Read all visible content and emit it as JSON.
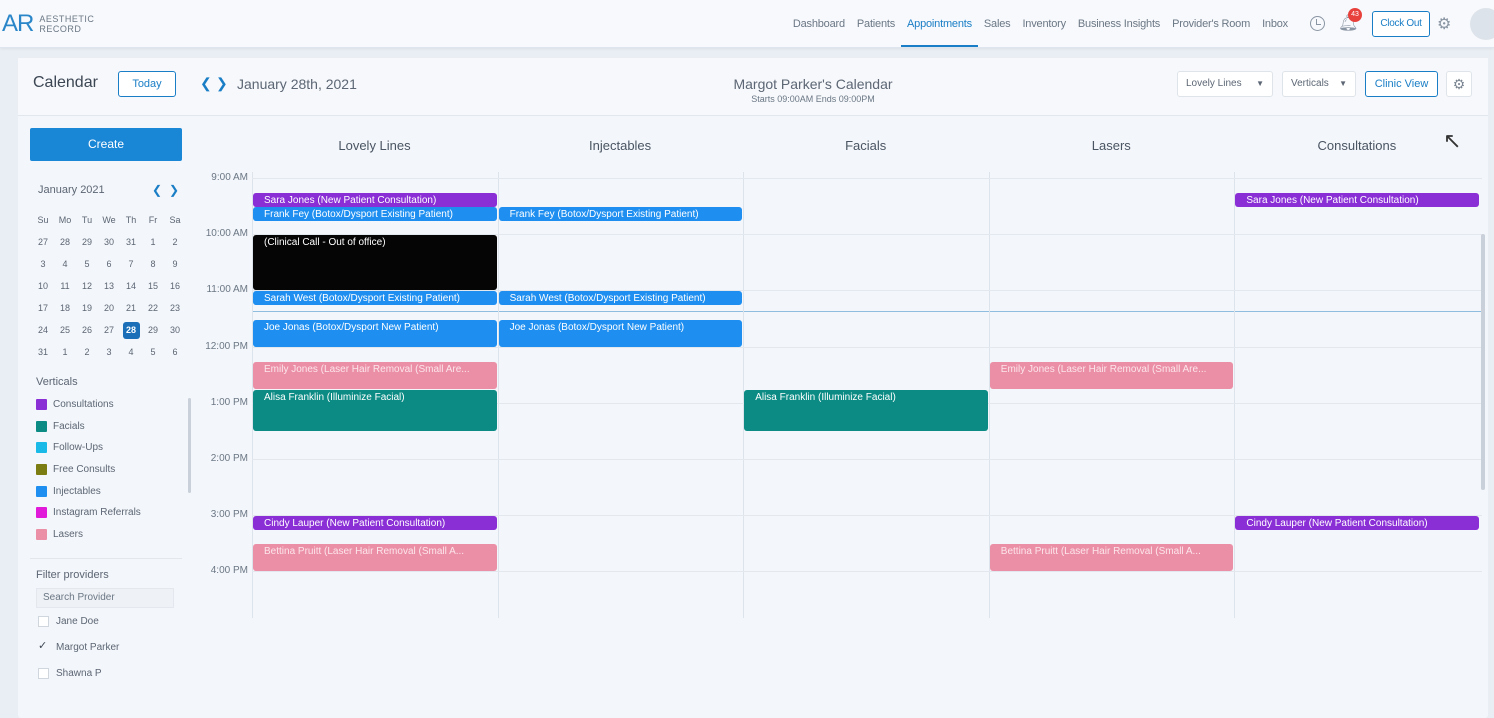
{
  "logo": {
    "mark": "AR",
    "line1": "AESTHETIC",
    "line2": "RECORD"
  },
  "nav": [
    "Dashboard",
    "Patients",
    "Appointments",
    "Sales",
    "Inventory",
    "Business Insights",
    "Provider's Room",
    "Inbox"
  ],
  "nav_active": "Appointments",
  "notifications": "43",
  "clock_out": "Clock Out",
  "header": {
    "title": "Calendar",
    "today": "Today",
    "date": "January 28th, 2021",
    "calendar_owner": "Margot Parker's Calendar",
    "hours": "Starts 09:00AM  Ends 09:00PM",
    "location": "Lovely Lines",
    "group": "Verticals",
    "view": "Clinic View"
  },
  "sidebar": {
    "create": "Create",
    "month": "January 2021",
    "weekdays": [
      "Su",
      "Mo",
      "Tu",
      "We",
      "Th",
      "Fr",
      "Sa"
    ],
    "days": [
      "27",
      "28",
      "29",
      "30",
      "31",
      "1",
      "2",
      "3",
      "4",
      "5",
      "6",
      "7",
      "8",
      "9",
      "10",
      "11",
      "12",
      "13",
      "14",
      "15",
      "16",
      "17",
      "18",
      "19",
      "20",
      "21",
      "22",
      "23",
      "24",
      "25",
      "26",
      "27",
      "28",
      "29",
      "30",
      "31",
      "1",
      "2",
      "3",
      "4",
      "5",
      "6"
    ],
    "selected_day": "28",
    "verticals_title": "Verticals",
    "verticals": [
      {
        "label": "Consultations",
        "color": "#8a2ed6"
      },
      {
        "label": "Facials",
        "color": "#0b8b84"
      },
      {
        "label": "Follow-Ups",
        "color": "#19b9e8"
      },
      {
        "label": "Free Consults",
        "color": "#7b7d12"
      },
      {
        "label": "Injectables",
        "color": "#1e8ff0"
      },
      {
        "label": "Instagram Referrals",
        "color": "#e01ad8"
      },
      {
        "label": "Lasers",
        "color": "#eb8fa6"
      }
    ],
    "filter_title": "Filter providers",
    "search_placeholder": "Search Provider",
    "providers": [
      {
        "name": "Jane Doe",
        "checked": false
      },
      {
        "name": "Margot Parker",
        "checked": true
      },
      {
        "name": "Shawna P",
        "checked": false
      }
    ]
  },
  "columns": [
    "Lovely Lines",
    "Injectables",
    "Facials",
    "Lasers",
    "Consultations"
  ],
  "times": [
    "9:00 AM",
    "10:00 AM",
    "11:00 AM",
    "12:00 PM",
    "1:00 PM",
    "2:00 PM",
    "3:00 PM",
    "4:00 PM"
  ],
  "events": [
    {
      "col": 0,
      "start": "9:15",
      "end": "9:30",
      "color": "c-purple",
      "label": "Sara Jones (New Patient Consultation)"
    },
    {
      "col": 0,
      "start": "9:30",
      "end": "9:45",
      "color": "c-blue",
      "label": "Frank Fey (Botox/Dysport Existing Patient)"
    },
    {
      "col": 0,
      "start": "10:00",
      "end": "11:00",
      "color": "c-black",
      "label": "(Clinical Call - Out of office)"
    },
    {
      "col": 0,
      "start": "11:00",
      "end": "11:15",
      "color": "c-blue",
      "label": "Sarah West (Botox/Dysport Existing Patient)"
    },
    {
      "col": 0,
      "start": "11:30",
      "end": "12:00",
      "color": "c-blue",
      "label": "Joe Jonas (Botox/Dysport New Patient)"
    },
    {
      "col": 0,
      "start": "12:15",
      "end": "12:45",
      "color": "c-pink",
      "label": "Emily Jones (Laser Hair Removal (Small Are..."
    },
    {
      "col": 0,
      "start": "12:45",
      "end": "13:30",
      "color": "c-teal",
      "label": "Alisa Franklin (Illuminize Facial)"
    },
    {
      "col": 0,
      "start": "15:00",
      "end": "15:15",
      "color": "c-purple",
      "label": "Cindy Lauper (New Patient Consultation)"
    },
    {
      "col": 0,
      "start": "15:30",
      "end": "16:00",
      "color": "c-pink",
      "label": "Bettina Pruitt (Laser Hair Removal (Small A..."
    },
    {
      "col": 1,
      "start": "9:30",
      "end": "9:45",
      "color": "c-blue",
      "label": "Frank Fey (Botox/Dysport Existing Patient)"
    },
    {
      "col": 1,
      "start": "11:00",
      "end": "11:15",
      "color": "c-blue",
      "label": "Sarah West (Botox/Dysport Existing Patient)"
    },
    {
      "col": 1,
      "start": "11:30",
      "end": "12:00",
      "color": "c-blue",
      "label": "Joe Jonas (Botox/Dysport New Patient)"
    },
    {
      "col": 2,
      "start": "12:45",
      "end": "13:30",
      "color": "c-teal",
      "label": "Alisa Franklin (Illuminize Facial)"
    },
    {
      "col": 3,
      "start": "12:15",
      "end": "12:45",
      "color": "c-pink",
      "label": "Emily Jones (Laser Hair Removal (Small Are..."
    },
    {
      "col": 3,
      "start": "15:30",
      "end": "16:00",
      "color": "c-pink",
      "label": "Bettina Pruitt (Laser Hair Removal (Small A..."
    },
    {
      "col": 4,
      "start": "9:15",
      "end": "9:30",
      "color": "c-purple",
      "label": "Sara Jones (New Patient Consultation)"
    },
    {
      "col": 4,
      "start": "15:00",
      "end": "15:15",
      "color": "c-purple",
      "label": "Cindy Lauper (New Patient Consultation)"
    }
  ]
}
